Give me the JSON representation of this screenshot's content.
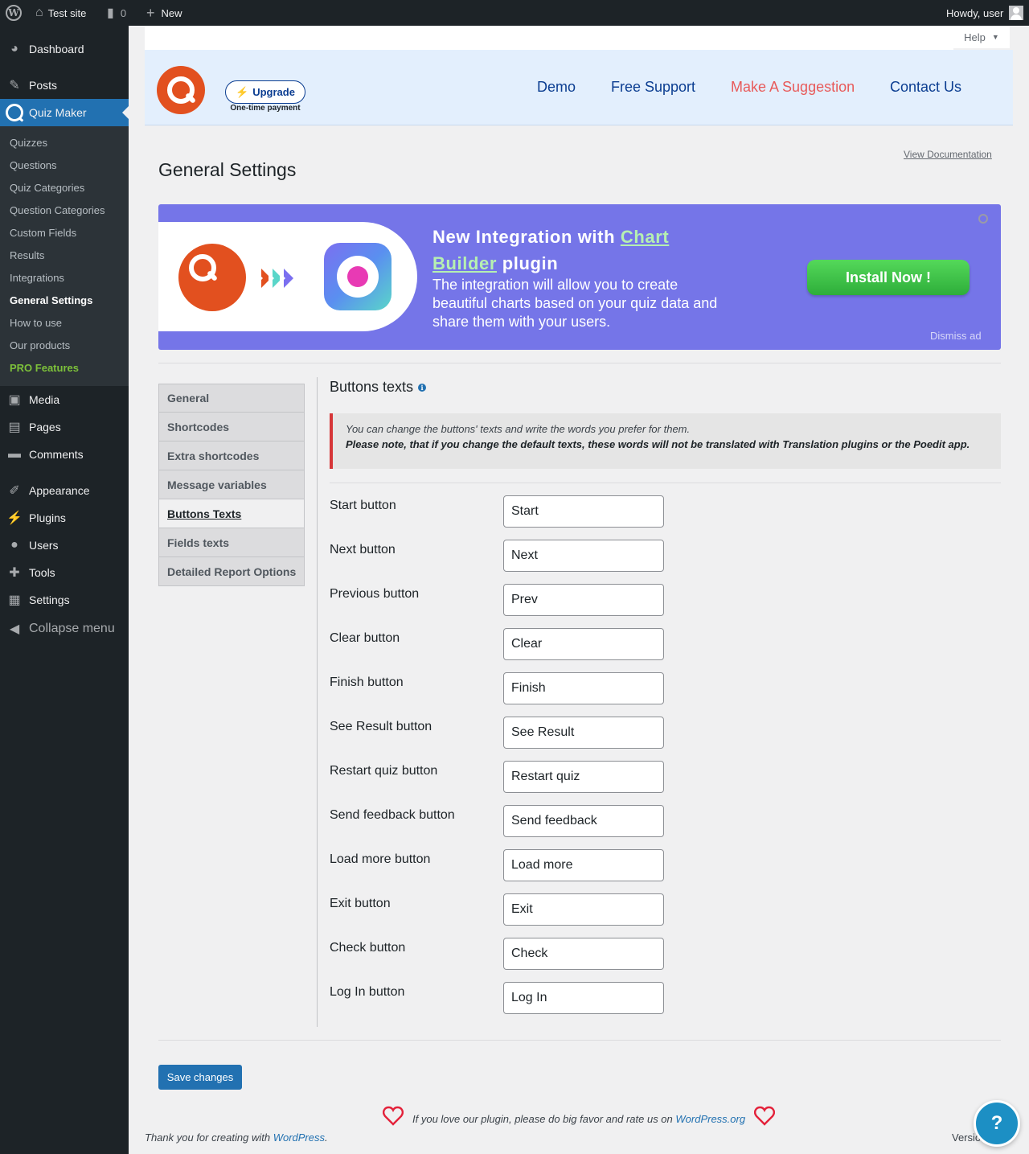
{
  "admin_bar": {
    "site_name": "Test site",
    "comments_count": "0",
    "new_label": "New",
    "howdy": "Howdy, user"
  },
  "sidebar": {
    "items": [
      {
        "label": "Dashboard",
        "icon": "dashboard-icon"
      },
      {
        "label": "Posts",
        "icon": "pin-icon"
      },
      {
        "label": "Quiz Maker",
        "icon": "quiz-maker-icon"
      },
      {
        "label": "Media",
        "icon": "media-icon"
      },
      {
        "label": "Pages",
        "icon": "pages-icon"
      },
      {
        "label": "Comments",
        "icon": "comment-icon"
      },
      {
        "label": "Appearance",
        "icon": "brush-icon"
      },
      {
        "label": "Plugins",
        "icon": "plug-icon"
      },
      {
        "label": "Users",
        "icon": "user-icon"
      },
      {
        "label": "Tools",
        "icon": "wrench-icon"
      },
      {
        "label": "Settings",
        "icon": "settings-icon"
      },
      {
        "label": "Collapse menu",
        "icon": "collapse-icon"
      }
    ],
    "submenu": [
      "Quizzes",
      "Questions",
      "Quiz Categories",
      "Question Categories",
      "Custom Fields",
      "Results",
      "Integrations",
      "General Settings",
      "How to use",
      "Our products",
      "PRO Features"
    ]
  },
  "help_tab": "Help",
  "header": {
    "upgrade_label": "Upgrade",
    "upgrade_note": "One-time payment",
    "links": [
      "Demo",
      "Free Support",
      "Make A Suggestion",
      "Contact Us"
    ]
  },
  "page": {
    "title": "General Settings",
    "view_doc": "View Documentation"
  },
  "banner": {
    "title_prefix": "New Integration with ",
    "title_link": "Chart Builder",
    "title_suffix": " plugin",
    "description": "The integration will allow you to create beautiful charts based on your quiz data and share them with your users.",
    "install_label": "Install Now !",
    "dismiss_label": "Dismiss ad"
  },
  "tabs": [
    "General",
    "Shortcodes",
    "Extra shortcodes",
    "Message variables",
    "Buttons Texts",
    "Fields texts",
    "Detailed Report Options"
  ],
  "active_tab": "Buttons Texts",
  "section": {
    "title": "Buttons texts",
    "notice_line1": "You can change the buttons' texts and write the words you prefer for them.",
    "notice_line2": "Please note, that if you change the default texts, these words will not be translated with Translation plugins or the Poedit app."
  },
  "buttons": [
    {
      "label": "Start button",
      "value": "Start"
    },
    {
      "label": "Next button",
      "value": "Next"
    },
    {
      "label": "Previous button",
      "value": "Prev"
    },
    {
      "label": "Clear button",
      "value": "Clear"
    },
    {
      "label": "Finish button",
      "value": "Finish"
    },
    {
      "label": "See Result button",
      "value": "See Result"
    },
    {
      "label": "Restart quiz button",
      "value": "Restart quiz"
    },
    {
      "label": "Send feedback button",
      "value": "Send feedback"
    },
    {
      "label": "Load more button",
      "value": "Load more"
    },
    {
      "label": "Exit button",
      "value": "Exit"
    },
    {
      "label": "Check button",
      "value": "Check"
    },
    {
      "label": "Log In button",
      "value": "Log In"
    }
  ],
  "save_label": "Save changes",
  "footer": {
    "rate_text": "If you love our plugin, please do big favor and rate us on ",
    "rate_link": "WordPress.org",
    "thanks_text": "Thank you for creating with ",
    "thanks_link": "WordPress",
    "thanks_end": ".",
    "version": "Versio"
  },
  "colors": {
    "admin_bar": "#1d2327",
    "accent": "#2271b1",
    "banner": "#7575e8",
    "install_green": "#3cbf45",
    "logo_orange": "#e2501f",
    "pro_green": "#7dc13a",
    "notice_red": "#d63638"
  }
}
